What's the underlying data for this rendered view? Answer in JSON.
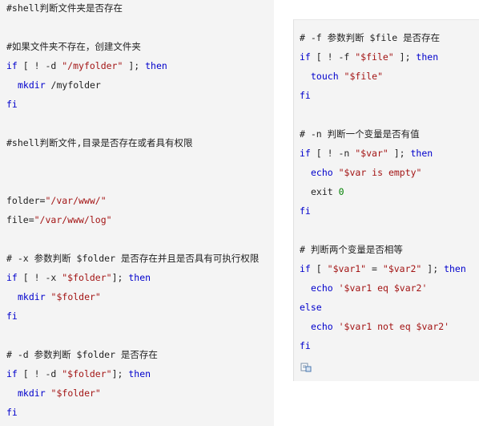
{
  "left": {
    "l1": "#shell判断文件夹是否存在",
    "l2": "#如果文件夹不存在，创建文件夹",
    "l3_if": "if",
    "l3_mid": " [ ! -d ",
    "l3_str": "\"/myfolder\"",
    "l3_end": " ]; ",
    "l3_then": "then",
    "l4_cmd": "mkdir",
    "l4_arg": " /myfolder",
    "l5": "fi",
    "l6": "#shell判断文件,目录是否存在或者具有权限",
    "l7_a": "folder=",
    "l7_b": "\"/var/www/\"",
    "l8_a": "file=",
    "l8_b": "\"/var/www/log\"",
    "l9": "# -x 参数判断 $folder 是否存在并且是否具有可执行权限",
    "l10_if": "if",
    "l10_mid": " [ ! -x ",
    "l10_str": "\"$folder\"",
    "l10_end": "]; ",
    "l10_then": "then",
    "l11_cmd": "mkdir",
    "l11_str": " \"$folder\"",
    "l12": "fi",
    "l13": "# -d 参数判断 $folder 是否存在",
    "l14_if": "if",
    "l14_mid": " [ ! -d ",
    "l14_str": "\"$folder\"",
    "l14_end": "]; ",
    "l14_then": "then",
    "l15_cmd": "mkdir",
    "l15_str": " \"$folder\"",
    "l16": "fi"
  },
  "right": {
    "r1": "# -f 参数判断 $file 是否存在",
    "r2_if": "if",
    "r2_mid": " [ ! -f ",
    "r2_str": "\"$file\"",
    "r2_end": " ]; ",
    "r2_then": "then",
    "r3_cmd": "touch",
    "r3_str": " \"$file\"",
    "r4": "fi",
    "r5": "# -n 判断一个变量是否有值",
    "r6_if": "if",
    "r6_mid": " [ ! -n ",
    "r6_str": "\"$var\"",
    "r6_end": " ]; ",
    "r6_then": "then",
    "r7_cmd": "echo",
    "r7_str": " \"$var is empty\"",
    "r8_a": "exit",
    "r8_num": " 0",
    "r9": "fi",
    "r10": "# 判断两个变量是否相等",
    "r11_if": "if",
    "r11_mid": " [ ",
    "r11_s1": "\"$var1\"",
    "r11_eq": " = ",
    "r11_s2": "\"$var2\"",
    "r11_end": " ]; ",
    "r11_then": "then",
    "r12_cmd": "echo",
    "r12_str": " '$var1 eq $var2'",
    "r13": "else",
    "r14_cmd": "echo",
    "r14_str": " '$var1 not eq $var2'",
    "r15": "fi"
  },
  "icons": {
    "copy": "copy-code-icon"
  }
}
